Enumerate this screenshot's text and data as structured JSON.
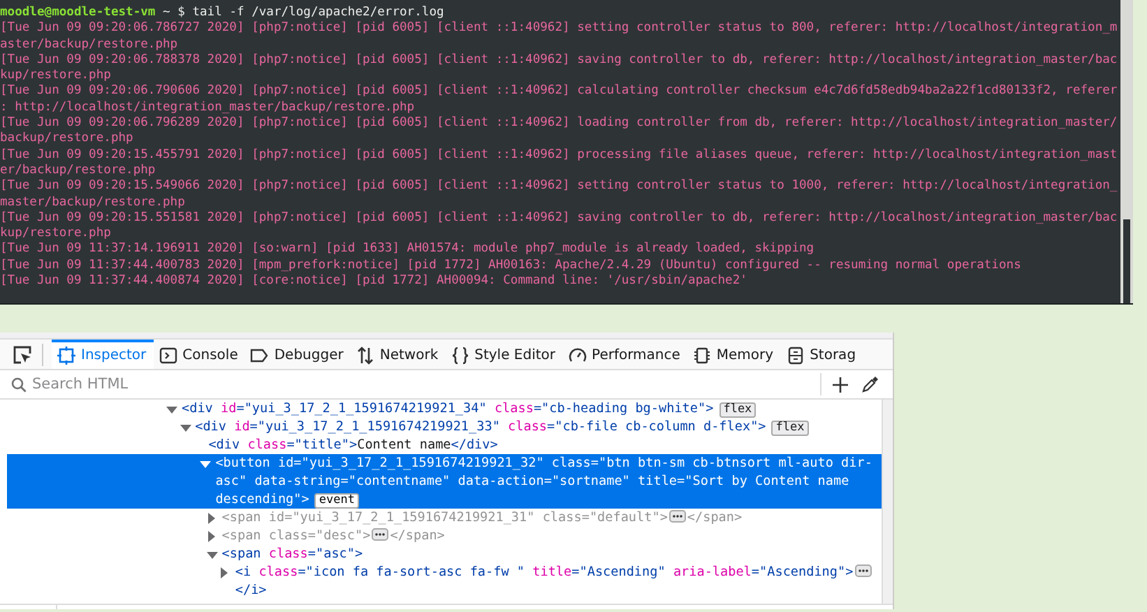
{
  "terminal": {
    "lines": [
      {
        "kind": "prompt",
        "user": "moodle@moodle-test-vm",
        "command": " ~ $ tail -f /var/log/apache2/error.log"
      },
      {
        "kind": "log",
        "text": "[Tue Jun 09 09:20:06.786727 2020] [php7:notice] [pid 6005] [client ::1:40962] setting controller status to 800, referer: http://localhost/integration_m"
      },
      {
        "kind": "log",
        "text": "aster/backup/restore.php"
      },
      {
        "kind": "log",
        "text": "[Tue Jun 09 09:20:06.788378 2020] [php7:notice] [pid 6005] [client ::1:40962] saving controller to db, referer: http://localhost/integration_master/bac"
      },
      {
        "kind": "log",
        "text": "kup/restore.php"
      },
      {
        "kind": "log",
        "text": "[Tue Jun 09 09:20:06.790606 2020] [php7:notice] [pid 6005] [client ::1:40962] calculating controller checksum e4c7d6fd58edb94ba2a22f1cd80133f2, referer"
      },
      {
        "kind": "log",
        "text": ": http://localhost/integration_master/backup/restore.php"
      },
      {
        "kind": "log",
        "text": "[Tue Jun 09 09:20:06.796289 2020] [php7:notice] [pid 6005] [client ::1:40962] loading controller from db, referer: http://localhost/integration_master/"
      },
      {
        "kind": "log",
        "text": "backup/restore.php"
      },
      {
        "kind": "log",
        "text": "[Tue Jun 09 09:20:15.455791 2020] [php7:notice] [pid 6005] [client ::1:40962] processing file aliases queue, referer: http://localhost/integration_mast"
      },
      {
        "kind": "log",
        "text": "er/backup/restore.php"
      },
      {
        "kind": "log",
        "text": "[Tue Jun 09 09:20:15.549066 2020] [php7:notice] [pid 6005] [client ::1:40962] setting controller status to 1000, referer: http://localhost/integration_"
      },
      {
        "kind": "log",
        "text": "master/backup/restore.php"
      },
      {
        "kind": "log",
        "text": "[Tue Jun 09 09:20:15.551581 2020] [php7:notice] [pid 6005] [client ::1:40962] saving controller to db, referer: http://localhost/integration_master/bac"
      },
      {
        "kind": "log",
        "text": "kup/restore.php"
      },
      {
        "kind": "log",
        "text": "[Tue Jun 09 11:37:14.196911 2020] [so:warn] [pid 1633] AH01574: module php7_module is already loaded, skipping"
      },
      {
        "kind": "log",
        "text": "[Tue Jun 09 11:37:44.400783 2020] [mpm_prefork:notice] [pid 1772] AH00163: Apache/2.4.29 (Ubuntu) configured -- resuming normal operations"
      },
      {
        "kind": "log",
        "text": "[Tue Jun 09 11:37:44.400874 2020] [core:notice] [pid 1772] AH00094: Command line: '/usr/sbin/apache2'"
      }
    ]
  },
  "devtools": {
    "tabs": [
      {
        "label": "Inspector",
        "selected": true
      },
      {
        "label": "Console",
        "selected": false
      },
      {
        "label": "Debugger",
        "selected": false
      },
      {
        "label": "Network",
        "selected": false
      },
      {
        "label": "Style Editor",
        "selected": false
      },
      {
        "label": "Performance",
        "selected": false
      },
      {
        "label": "Memory",
        "selected": false
      },
      {
        "label": "Storag",
        "selected": false
      }
    ],
    "search": {
      "placeholder": "Search HTML"
    },
    "tree": {
      "nodes": [
        {
          "expanded": true,
          "selected": false,
          "dimmed": false,
          "collapsed": false,
          "open_tag": "<div id=\"yui_3_17_2_1_1591674219921_34\" class=\"cb-heading bg-white\">",
          "badge": "flex",
          "children": [
            {
              "expanded": true,
              "selected": false,
              "dimmed": false,
              "collapsed": false,
              "open_tag": "<div id=\"yui_3_17_2_1_1591674219921_33\" class=\"cb-file cb-column d-flex\">",
              "badge": "flex",
              "children": [
                {
                  "selected": false,
                  "dimmed": false,
                  "collapsed": false,
                  "open_tag": "<div class=\"title\">",
                  "content": "Content name",
                  "close_tag": "</div>"
                },
                {
                  "expanded": true,
                  "selected": true,
                  "dimmed": false,
                  "collapsed": false,
                  "open_tag": "<button id=\"yui_3_17_2_1_1591674219921_32\" class=\"btn btn-sm cb-btnsort ml-auto dir-asc\" data-string=\"contentname\" data-action=\"sortname\" title=\"Sort by Content name descending\">",
                  "badge": "event",
                  "children": [
                    {
                      "expanded": false,
                      "selected": false,
                      "dimmed": true,
                      "collapsed": true,
                      "open_tag": "<span id=\"yui_3_17_2_1_1591674219921_31\" class=\"default\">",
                      "close_tag": "</span>"
                    },
                    {
                      "expanded": false,
                      "selected": false,
                      "dimmed": true,
                      "collapsed": true,
                      "open_tag": "<span class=\"desc\">",
                      "close_tag": "</span>"
                    },
                    {
                      "expanded": true,
                      "selected": false,
                      "dimmed": false,
                      "collapsed": false,
                      "open_tag": "<span class=\"asc\">",
                      "children": [
                        {
                          "expanded": false,
                          "selected": false,
                          "dimmed": false,
                          "collapsed": true,
                          "open_tag": "<i class=\"icon fa fa-sort-asc fa-fw \" title=\"Ascending\" aria-label=\"Ascending\">",
                          "close_tag": "</i>"
                        }
                      ]
                    }
                  ]
                }
              ]
            }
          ]
        }
      ]
    }
  }
}
